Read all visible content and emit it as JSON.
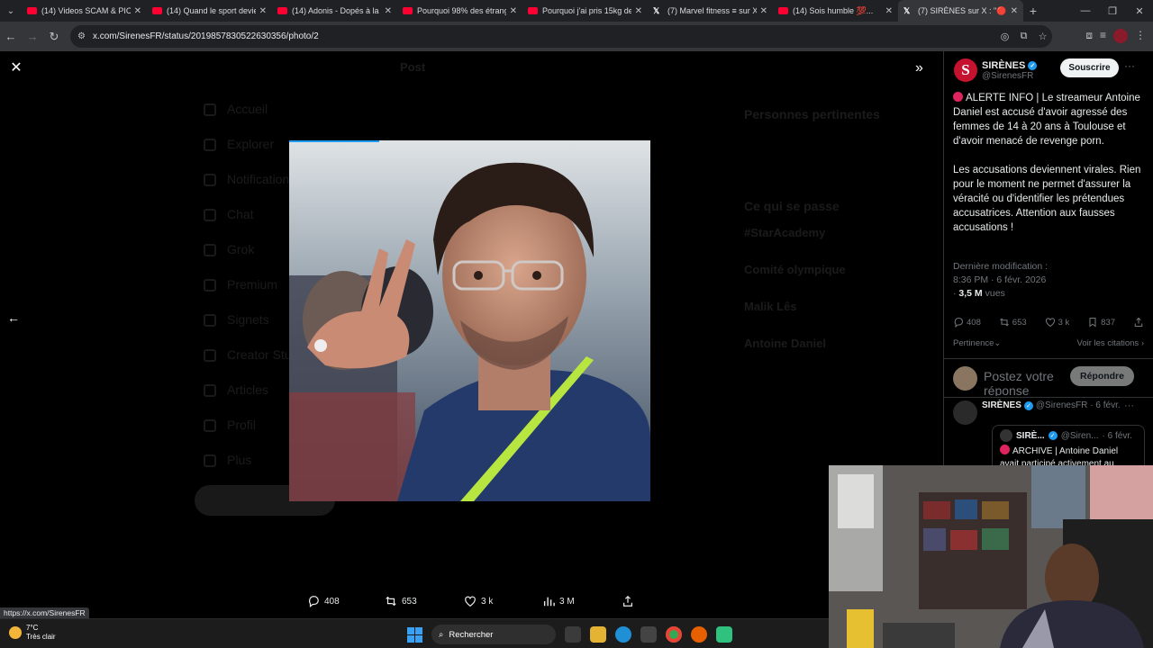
{
  "browser": {
    "tabs": [
      {
        "title": "(14) Videos SCAM & PIC...",
        "favicon": "youtube-icon"
      },
      {
        "title": "(14) Quand le sport devie...",
        "favicon": "youtube-icon"
      },
      {
        "title": "(14) Adonis - Dopés à la n...",
        "favicon": "youtube-icon"
      },
      {
        "title": "Pourquoi 98% des étrang...",
        "favicon": "youtube-icon"
      },
      {
        "title": "Pourquoi j'ai pris 15kg de...",
        "favicon": "youtube-icon"
      },
      {
        "title": "(7) Marvel fitness ≡ sur X...",
        "favicon": "x-icon"
      },
      {
        "title": "(14) Sois humble 💯...",
        "favicon": "youtube-icon"
      },
      {
        "title": "(7) SIRÈNES sur X : \"🔴 AL...",
        "favicon": "x-icon",
        "active": true
      }
    ],
    "url": "x.com/SirenesFR/status/2019857830522630356/photo/2",
    "status_url": "https://x.com/SirenesFR"
  },
  "background_dimmed": {
    "nav": [
      "Accueil",
      "Explorer",
      "Notifications",
      "Chat",
      "Grok",
      "Premium",
      "Signets",
      "Creator Stu",
      "Articles",
      "Profil",
      "Plus"
    ],
    "post_header": "Post",
    "right": {
      "relevant_title": "Personnes pertinentes",
      "trending_title": "Ce qui se passe",
      "trends": [
        "#StarAcademy",
        "Comité olympique",
        "Malik Lês",
        "Antoine Daniel"
      ]
    }
  },
  "photo_viewer": {
    "actions": {
      "replies": "408",
      "reposts": "653",
      "likes": "3 k",
      "views": "3 M"
    },
    "progress": 0.25
  },
  "side_panel": {
    "author": {
      "name": "SIRÈNES",
      "handle": "@SirenesFR",
      "avatar_letter": "S"
    },
    "subscribe_label": "Souscrire",
    "tweet_p1": "ALERTE INFO | Le streameur Antoine Daniel est accusé d'avoir agressé des femmes de 14 à 20 ans à Toulouse et d'avoir menacé de revenge porn.",
    "tweet_p2": "Les accusations deviennent virales. Rien pour le moment ne permet d'assurer la véracité ou d'identifier les prétendues accusatrices. Attention aux fausses accusations !",
    "last_modified_label": "Dernière modification :",
    "timestamp": "8:36 PM · 6 févr. 2026",
    "views_count": "3,5 M",
    "views_label": "vues",
    "stats": {
      "replies": "408",
      "reposts": "653",
      "likes": "3 k",
      "bookmarks": "837"
    },
    "sort_label": "Pertinence",
    "quotes_label": "Voir les citations",
    "reply_placeholder": "Postez votre réponse",
    "reply_button": "Répondre",
    "reply": {
      "name": "SIRÈNES",
      "handle": "@SirenesFR",
      "date": "· 6 févr.",
      "quote": {
        "name": "SIRÈ...",
        "handle": "@Siren...",
        "date": "· 6 févr.",
        "text": "ARCHIVE | Antoine Daniel avait participé activement au"
      }
    }
  },
  "taskbar": {
    "weather_temp": "7°C",
    "weather_desc": "Très clair",
    "search_label": "Rechercher"
  },
  "colors": {
    "accent": "#1d9bf0",
    "alert": "#e0245e",
    "brand": "#c4122f"
  }
}
